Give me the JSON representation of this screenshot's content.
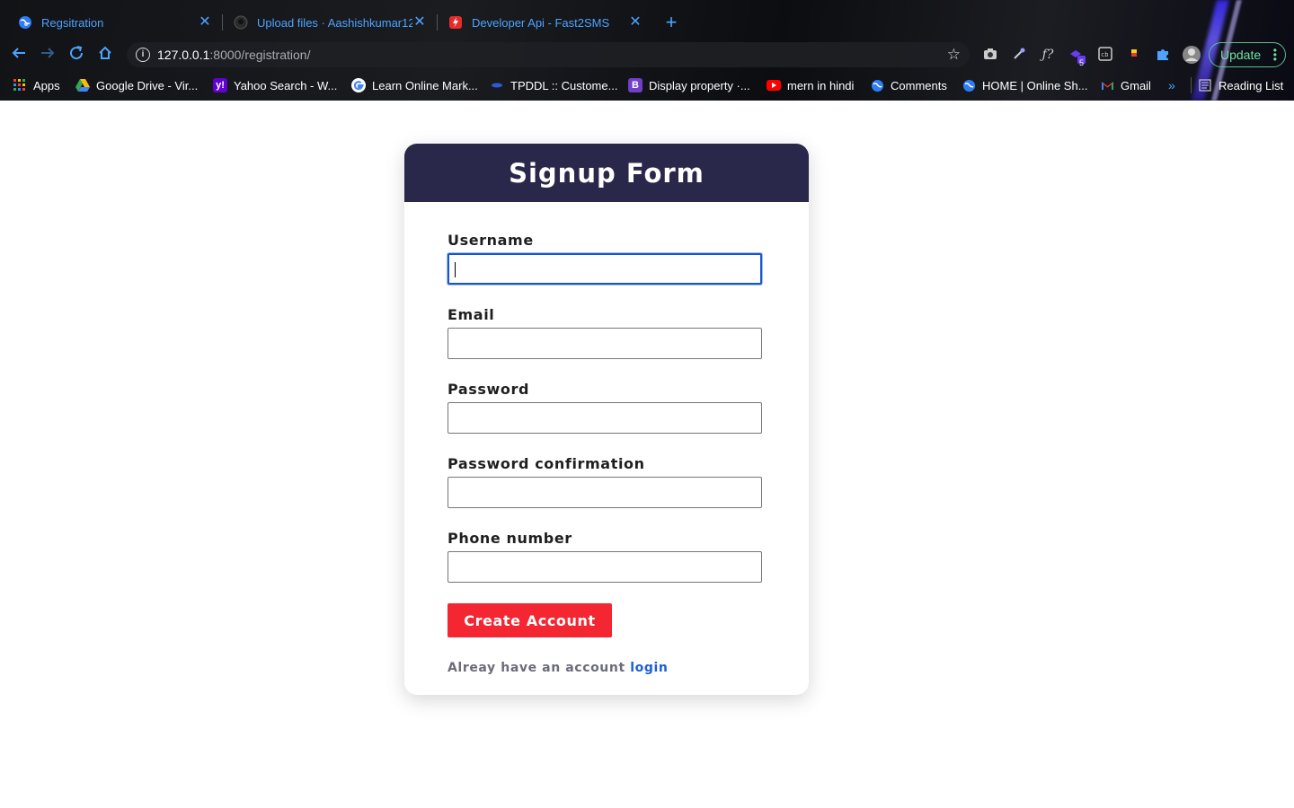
{
  "browser": {
    "tabs": [
      {
        "title": "Regsitration",
        "active": true
      },
      {
        "title": "Upload files · Aashishkumar12…",
        "active": false
      },
      {
        "title": "Developer Api - Fast2SMS",
        "active": false
      }
    ],
    "address": {
      "host": "127.0.0.1",
      "path": ":8000/registration/"
    },
    "update_label": "Update",
    "extension_badge": "5",
    "bookmarks": [
      {
        "label": "Apps",
        "icon": "apps-grid-icon"
      },
      {
        "label": "Google Drive - Vir...",
        "icon": "google-drive-icon"
      },
      {
        "label": "Yahoo Search - W...",
        "icon": "yahoo-icon"
      },
      {
        "label": "Learn Online Mark...",
        "icon": "google-icon"
      },
      {
        "label": "TPDDL :: Custome...",
        "icon": "tpddl-icon"
      },
      {
        "label": "Display property ·...",
        "icon": "bootstrap-icon"
      },
      {
        "label": "mern in hindi",
        "icon": "youtube-icon"
      },
      {
        "label": "Comments",
        "icon": "globe-icon"
      },
      {
        "label": "HOME | Online Sh...",
        "icon": "globe-icon"
      },
      {
        "label": "Gmail",
        "icon": "gmail-icon"
      }
    ],
    "reading_list": "Reading List"
  },
  "page": {
    "title": "Signup Form",
    "fields": [
      {
        "label": "Username",
        "value": ""
      },
      {
        "label": "Email",
        "value": ""
      },
      {
        "label": "Password",
        "value": ""
      },
      {
        "label": "Password confirmation",
        "value": ""
      },
      {
        "label": "Phone number",
        "value": ""
      }
    ],
    "submit_label": "Create Account",
    "footer_text": "Alreay have an account",
    "footer_link": "login"
  },
  "colors": {
    "header_bg": "#29284a",
    "submit_bg": "#f32632",
    "link": "#1a5fd8",
    "focus_border": "#1a56c9"
  }
}
